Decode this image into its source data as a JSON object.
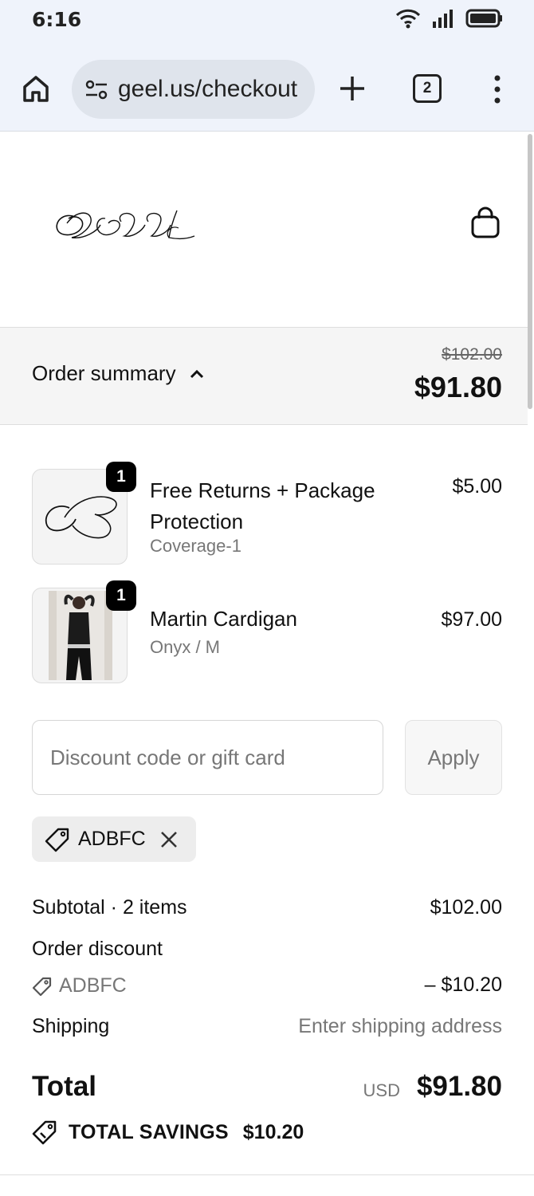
{
  "status_bar": {
    "time": "6:16"
  },
  "browser": {
    "url": "geel.us/checkout",
    "tab_count": "2"
  },
  "header": {
    "logo_text": "GEEL"
  },
  "summary": {
    "label": "Order summary",
    "original_price": "$102.00",
    "price": "$91.80"
  },
  "items": [
    {
      "quantity": "1",
      "title": "Free Returns + Package Protection",
      "subtitle": "Coverage-1",
      "price": "$5.00"
    },
    {
      "quantity": "1",
      "title": "Martin Cardigan",
      "subtitle": "Onyx / M",
      "price": "$97.00"
    }
  ],
  "discount": {
    "placeholder": "Discount code or gift card",
    "apply_label": "Apply",
    "applied_code": "ADBFC"
  },
  "totals": {
    "subtotal_label": "Subtotal · 2 items",
    "subtotal_value": "$102.00",
    "order_discount_label": "Order discount",
    "discount_code": "ADBFC",
    "discount_value": "– $10.20",
    "shipping_label": "Shipping",
    "shipping_value": "Enter shipping address",
    "total_label": "Total",
    "currency": "USD",
    "total_value": "$91.80",
    "savings_label": "TOTAL SAVINGS",
    "savings_value": "$10.20"
  },
  "colors": {
    "chrome_bg": "#eff3fb",
    "url_pill": "#dfe4ec",
    "summary_bg": "#f5f5f5",
    "badge": "#000000",
    "muted_text": "#777777"
  }
}
